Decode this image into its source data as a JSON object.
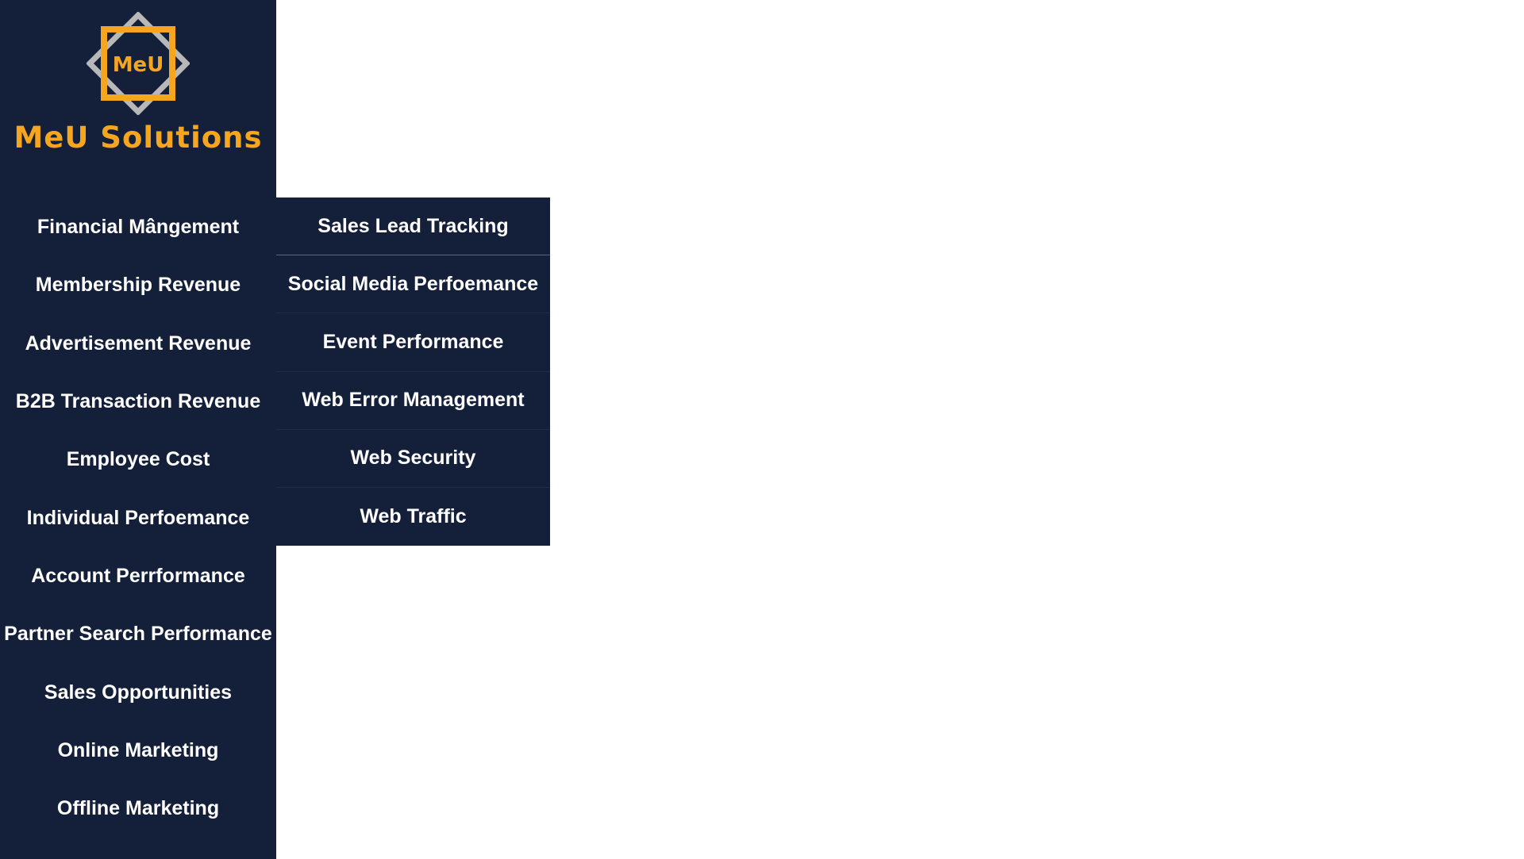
{
  "brand": {
    "logo_text": "MeU",
    "name": "MeU Solutions",
    "colors": {
      "accent": "#f6a51f",
      "frame": "#b8b8b8",
      "background": "#14203a"
    }
  },
  "main_menu": [
    {
      "label": "Financial Mângement"
    },
    {
      "label": "Membership Revenue"
    },
    {
      "label": "Advertisement Revenue"
    },
    {
      "label": "B2B Transaction Revenue"
    },
    {
      "label": "Employee Cost"
    },
    {
      "label": "Individual Perfoemance"
    },
    {
      "label": "Account Perrformance"
    },
    {
      "label": "Partner Search Performance"
    },
    {
      "label": "Sales Opportunities"
    },
    {
      "label": "Online Marketing"
    },
    {
      "label": "Offline Marketing"
    }
  ],
  "submenu": [
    {
      "label": "Sales Lead Tracking"
    },
    {
      "label": "Social Media Perfoemance"
    },
    {
      "label": "Event Performance"
    },
    {
      "label": "Web Error Management"
    },
    {
      "label": "Web Security"
    },
    {
      "label": "Web Traffic"
    }
  ]
}
